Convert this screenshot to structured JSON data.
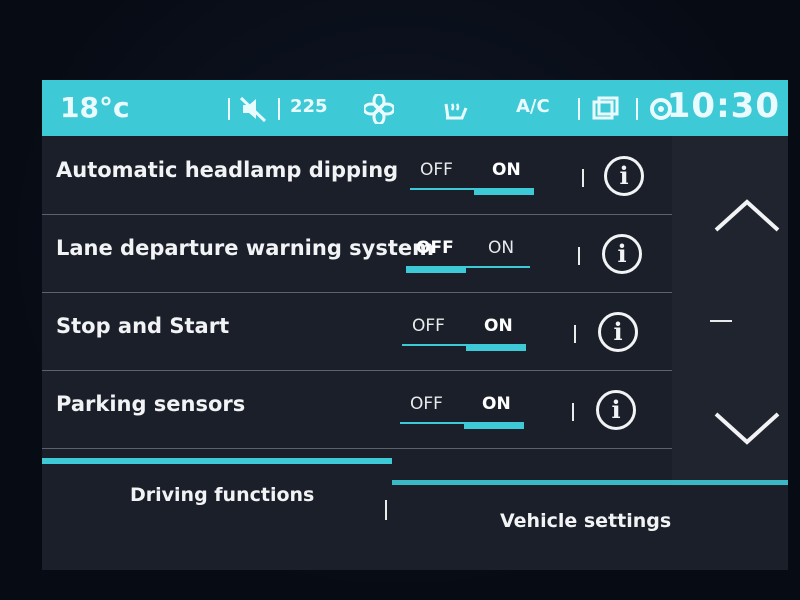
{
  "status": {
    "temperature": "18°c",
    "fan_speed": "225",
    "ac_label": "A/C",
    "time": "10:30",
    "icons": [
      "mute-icon",
      "fan-icon",
      "seat-heat-icon",
      "recirculation-icon",
      "settings-icon"
    ]
  },
  "settings": [
    {
      "label": "Automatic headlamp dipping",
      "off_label": "OFF",
      "on_label": "ON",
      "state": "ON"
    },
    {
      "label": "Lane departure warning system",
      "off_label": "OFF",
      "on_label": "ON",
      "state": "OFF"
    },
    {
      "label": "Stop and Start",
      "off_label": "OFF",
      "on_label": "ON",
      "state": "ON"
    },
    {
      "label": "Parking sensors",
      "off_label": "OFF",
      "on_label": "ON",
      "state": "ON"
    }
  ],
  "info_glyph": "i",
  "tabs": {
    "left": "Driving functions",
    "right": "Vehicle settings",
    "active": "left"
  },
  "colors": {
    "accent": "#3ec9d6",
    "background": "#1b1f29",
    "text": "#f2f3f5"
  }
}
